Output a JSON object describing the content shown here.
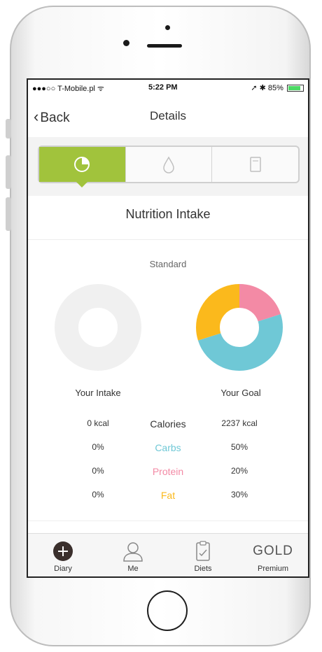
{
  "status_bar": {
    "carrier": "●●●○○ T-Mobile.pl ᯤ",
    "time": "5:22 PM",
    "battery": "85%",
    "battery_level": 0.85
  },
  "nav": {
    "back_label": "Back",
    "title": "Details"
  },
  "segments": [
    {
      "icon": "pie-chart-icon",
      "active": true
    },
    {
      "icon": "water-drop-icon",
      "active": false
    },
    {
      "icon": "document-icon",
      "active": false
    }
  ],
  "section": {
    "title": "Nutrition Intake",
    "subtitle": "Standard"
  },
  "captions": {
    "intake": "Your Intake",
    "goal": "Your Goal"
  },
  "nutrition_rows": [
    {
      "intake": "0 kcal",
      "label": "Calories",
      "goal": "2237 kcal",
      "color": "#333333"
    },
    {
      "intake": "0%",
      "label": "Carbs",
      "goal": "50%",
      "color": "#6fc8d6"
    },
    {
      "intake": "0%",
      "label": "Protein",
      "goal": "20%",
      "color": "#f38aa5"
    },
    {
      "intake": "0%",
      "label": "Fat",
      "goal": "30%",
      "color": "#fbb91c"
    }
  ],
  "goal_chart": {
    "carbs": 50,
    "protein": 20,
    "fat": 30
  },
  "tabs": [
    {
      "label": "Diary",
      "icon": "plus-circle-icon"
    },
    {
      "label": "Me",
      "icon": "person-icon"
    },
    {
      "label": "Diets",
      "icon": "clipboard-icon"
    },
    {
      "label": "Premium",
      "icon_text": "GOLD"
    }
  ],
  "colors": {
    "accent": "#a1c33c",
    "carbs": "#6fc8d6",
    "protein": "#f38aa5",
    "fat": "#fbb91c",
    "empty": "#f0f0f0"
  }
}
